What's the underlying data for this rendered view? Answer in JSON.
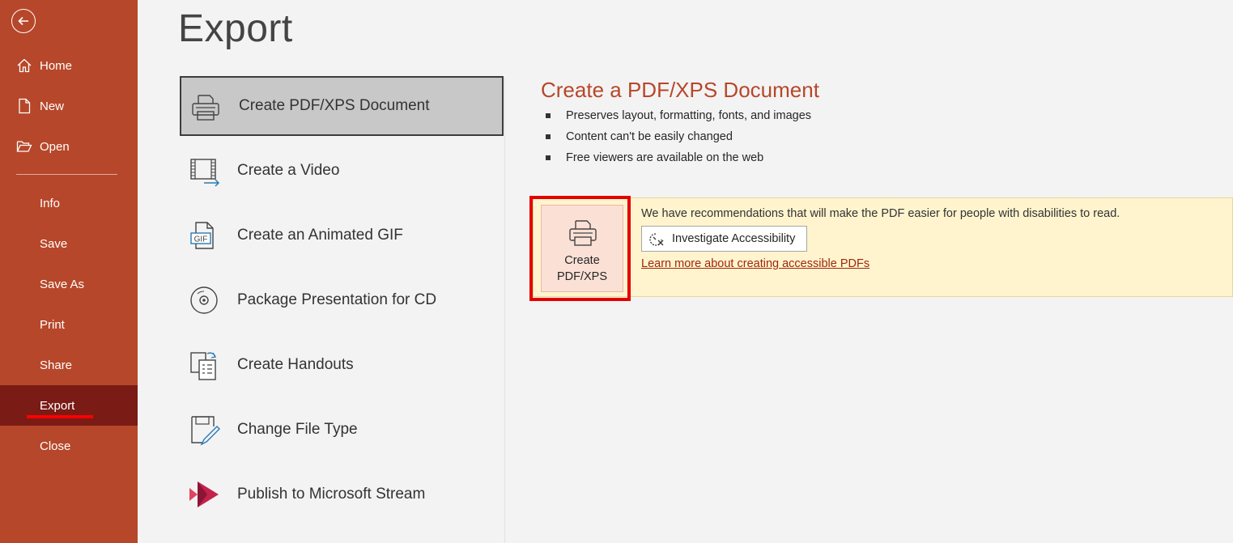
{
  "sidebar": {
    "back_icon": "back-arrow-icon",
    "items": [
      {
        "label": "Home",
        "icon": "home-icon"
      },
      {
        "label": "New",
        "icon": "new-document-icon"
      },
      {
        "label": "Open",
        "icon": "open-folder-icon"
      },
      {
        "label": "Info"
      },
      {
        "label": "Save"
      },
      {
        "label": "Save As"
      },
      {
        "label": "Print"
      },
      {
        "label": "Share"
      },
      {
        "label": "Export",
        "active": true
      },
      {
        "label": "Close"
      }
    ]
  },
  "main": {
    "title": "Export",
    "options": [
      {
        "label": "Create PDF/XPS Document",
        "icon": "pdf-document-icon",
        "selected": true
      },
      {
        "label": "Create a Video",
        "icon": "video-icon"
      },
      {
        "label": "Create an Animated GIF",
        "icon": "gif-icon"
      },
      {
        "label": "Package Presentation for CD",
        "icon": "cd-icon"
      },
      {
        "label": "Create Handouts",
        "icon": "handouts-icon"
      },
      {
        "label": "Change File Type",
        "icon": "change-file-type-icon"
      },
      {
        "label": "Publish to Microsoft Stream",
        "icon": "microsoft-stream-icon"
      }
    ]
  },
  "detail": {
    "title": "Create a PDF/XPS Document",
    "bullets": [
      "Preserves layout, formatting, fonts, and images",
      "Content can't be easily changed",
      "Free viewers are available on the web"
    ],
    "create_button": {
      "line1": "Create",
      "line2": "PDF/XPS",
      "icon": "pdf-document-icon"
    },
    "recommendation_text": "We have recommendations that will make the PDF easier for people with disabilities to read.",
    "investigate_button": "Investigate Accessibility",
    "learn_link": "Learn more about creating accessible PDFs"
  },
  "colors": {
    "sidebar_bg": "#b7472a",
    "sidebar_active": "#7a1b16",
    "accent_title": "#b7472a",
    "banner_bg": "#fff4ce",
    "highlight_red": "#e50000"
  }
}
